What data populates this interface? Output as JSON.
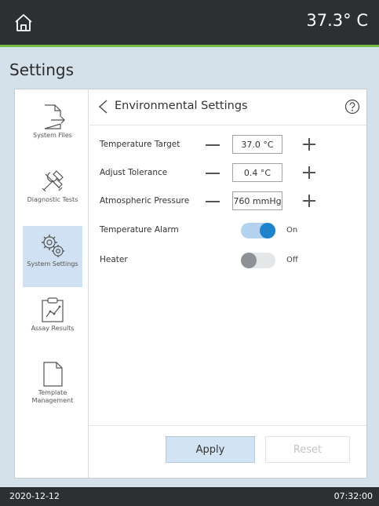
{
  "topbar": {
    "temperature": "37.3° C"
  },
  "page": {
    "title": "Settings"
  },
  "sidebar": {
    "items": [
      {
        "label": "System Files",
        "icon": "file-export-icon",
        "active": false
      },
      {
        "label": "Diagnostic Tests",
        "icon": "tools-icon",
        "active": false
      },
      {
        "label": "System Settings",
        "icon": "gears-icon",
        "active": true
      },
      {
        "label": "Assay Results",
        "icon": "clipboard-chart-icon",
        "active": false
      },
      {
        "label": "Template Management",
        "icon": "document-icon",
        "active": false
      }
    ]
  },
  "content": {
    "title": "Environmental Settings",
    "settings": [
      {
        "label": "Temperature Target",
        "value": "37.0 °C"
      },
      {
        "label": "Adjust Tolerance",
        "value": "0.4 °C"
      },
      {
        "label": "Atmospheric Pressure",
        "value": "760 mmHg"
      }
    ],
    "toggles": [
      {
        "label": "Temperature Alarm",
        "state": "On",
        "on": true
      },
      {
        "label": "Heater",
        "state": "Off",
        "on": false
      }
    ],
    "apply_label": "Apply",
    "reset_label": "Reset"
  },
  "statusbar": {
    "date": "2020-12-12",
    "time": "07:32:00"
  },
  "colors": {
    "accent_green": "#76bc43",
    "toggle_on": "#1e83cc",
    "active_nav": "#cfe1f2",
    "header_bg": "#2d3033",
    "panel_bg": "#d5e1ea"
  }
}
